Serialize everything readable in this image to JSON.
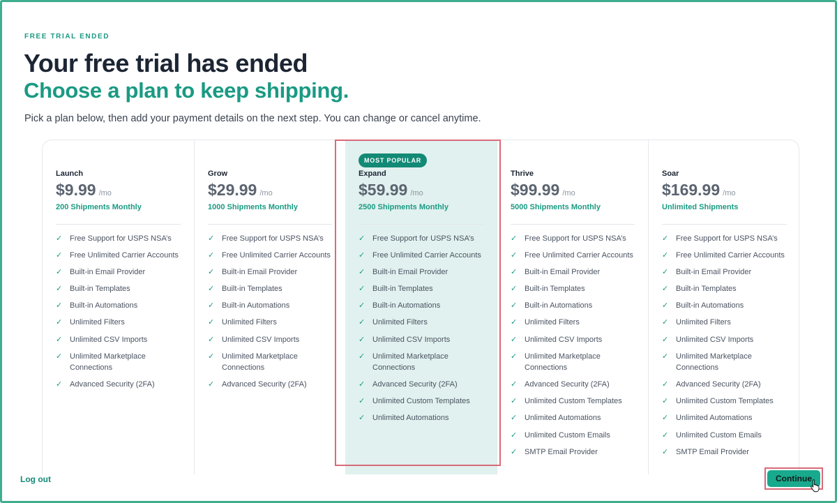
{
  "header": {
    "eyebrow": "FREE TRIAL ENDED",
    "title": "Your free trial has ended",
    "subtitle": "Choose a plan to keep shipping.",
    "intro": "Pick a plan below, then add your payment details on the next step. You can change or cancel anytime."
  },
  "colors": {
    "accent": "#1a9a83",
    "highlight_bg": "#e1f1ef",
    "selection_outline": "#d86a78",
    "button": "#19a98d"
  },
  "plans": [
    {
      "name": "Launch",
      "price": "$9.99",
      "per": "/mo",
      "shipments": "200 Shipments Monthly",
      "features": [
        "Free Support for USPS NSA’s",
        "Free Unlimited Carrier Accounts",
        "Built-in Email Provider",
        "Built-in Templates",
        "Built-in Automations",
        "Unlimited Filters",
        "Unlimited CSV Imports",
        "Unlimited Marketplace Connections",
        "Advanced Security (2FA)"
      ]
    },
    {
      "name": "Grow",
      "price": "$29.99",
      "per": "/mo",
      "shipments": "1000 Shipments Monthly",
      "features": [
        "Free Support for USPS NSA’s",
        "Free Unlimited Carrier Accounts",
        "Built-in Email Provider",
        "Built-in Templates",
        "Built-in Automations",
        "Unlimited Filters",
        "Unlimited CSV Imports",
        "Unlimited Marketplace Connections",
        "Advanced Security (2FA)"
      ]
    },
    {
      "name": "Expand",
      "price": "$59.99",
      "per": "/mo",
      "shipments": "2500 Shipments Monthly",
      "badge": "MOST POPULAR",
      "selected": true,
      "features": [
        "Free Support for USPS NSA’s",
        "Free Unlimited Carrier Accounts",
        "Built-in Email Provider",
        "Built-in Templates",
        "Built-in Automations",
        "Unlimited Filters",
        "Unlimited CSV Imports",
        "Unlimited Marketplace Connections",
        "Advanced Security (2FA)",
        "Unlimited Custom Templates",
        "Unlimited Automations"
      ]
    },
    {
      "name": "Thrive",
      "price": "$99.99",
      "per": "/mo",
      "shipments": "5000 Shipments Monthly",
      "features": [
        "Free Support for USPS NSA’s",
        "Free Unlimited Carrier Accounts",
        "Built-in Email Provider",
        "Built-in Templates",
        "Built-in Automations",
        "Unlimited Filters",
        "Unlimited CSV Imports",
        "Unlimited Marketplace Connections",
        "Advanced Security (2FA)",
        "Unlimited Custom Templates",
        "Unlimited Automations",
        "Unlimited Custom Emails",
        "SMTP Email Provider"
      ]
    },
    {
      "name": "Soar",
      "price": "$169.99",
      "per": "/mo",
      "shipments": "Unlimited Shipments",
      "features": [
        "Free Support for USPS NSA’s",
        "Free Unlimited Carrier Accounts",
        "Built-in Email Provider",
        "Built-in Templates",
        "Built-in Automations",
        "Unlimited Filters",
        "Unlimited CSV Imports",
        "Unlimited Marketplace Connections",
        "Advanced Security (2FA)",
        "Unlimited Custom Templates",
        "Unlimited Automations",
        "Unlimited Custom Emails",
        "SMTP Email Provider"
      ]
    }
  ],
  "footer": {
    "logout_label": "Log out",
    "continue_label": "Continue"
  },
  "icons": {
    "feature_check": "check-icon",
    "pointer": "hand-pointer-cursor-icon"
  }
}
